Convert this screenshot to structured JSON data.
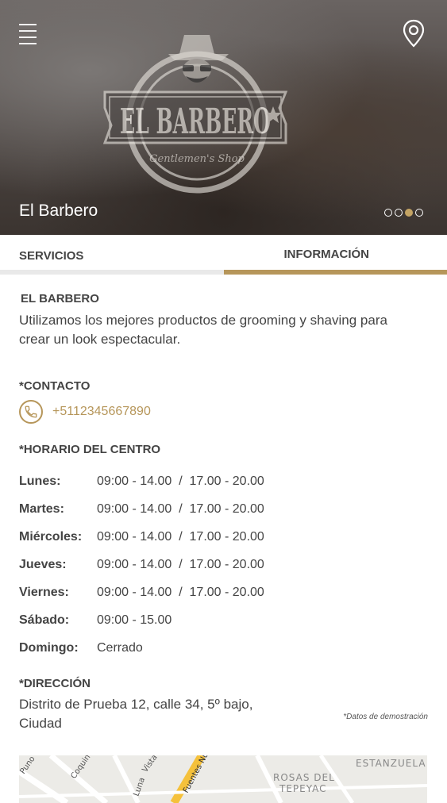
{
  "hero": {
    "title": "El Barbero",
    "logo_text": "EL BARBERO",
    "logo_subtext": "Gentlemen's Shop",
    "carousel_total": 4,
    "carousel_active": 3
  },
  "tabs": [
    {
      "label": "SERVICIOS",
      "active": false
    },
    {
      "label": "INFORMACIÓN",
      "active": true
    }
  ],
  "info": {
    "name": "EL BARBERO",
    "description": "Utilizamos los mejores productos de grooming y shaving para crear un look espectacular.",
    "contact_heading": "*CONTACTO",
    "phone": "+5112345667890",
    "hours_heading": "*HORARIO DEL CENTRO",
    "hours": [
      {
        "day": "Lunes:",
        "value": "09:00 - 14.00  /  17.00 - 20.00"
      },
      {
        "day": "Martes:",
        "value": "09:00 - 14.00  /  17.00 - 20.00"
      },
      {
        "day": "Miércoles:",
        "value": "09:00 - 14.00  /  17.00 - 20.00"
      },
      {
        "day": "Jueves:",
        "value": "09:00 - 14.00  /  17.00 - 20.00"
      },
      {
        "day": "Viernes:",
        "value": "09:00 - 14.00  /  17.00 - 20.00"
      },
      {
        "day": "Sábado:",
        "value": "09:00 - 15.00"
      },
      {
        "day": "Domingo:",
        "value": "Cerrado"
      }
    ],
    "address_heading": "*DIRECCIÓN",
    "address": "Distrito de Prueba 12, calle 34, 5º bajo, Ciudad",
    "demo_note": "*Datos de demostración"
  },
  "map": {
    "labels": [
      "Coquimbo",
      "ESTANZUELA",
      "ROSAS DEL",
      "TEPEYAC",
      "Puno",
      "Vista",
      "Fuentes Nu",
      "Luna"
    ]
  },
  "colors": {
    "accent": "#b6965a",
    "text": "#444444",
    "tab_inactive_bar": "#e9e9e9"
  }
}
